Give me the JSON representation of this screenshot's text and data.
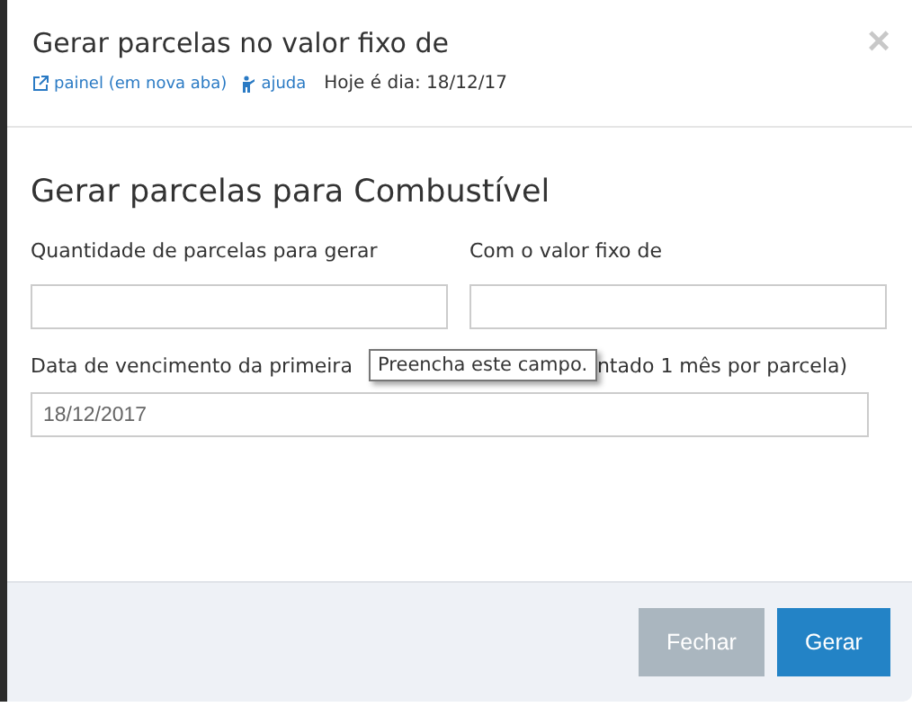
{
  "modal": {
    "title": "Gerar parcelas no valor fixo de",
    "close": "×",
    "links": [
      {
        "kind": "external",
        "label": "painel (em nova aba)"
      },
      {
        "kind": "help",
        "label": "ajuda"
      }
    ],
    "today": "Hoje é dia: 18/12/17"
  },
  "form": {
    "heading": "Gerar parcelas para Combustível",
    "quantity": {
      "label": "Quantidade de parcelas para gerar"
    },
    "fixed_value": {
      "label": "Com o valor fixo de"
    },
    "due_date": {
      "label_start": "Data de vencimento da primeira",
      "label_end": "ntado 1 mês por parcela)",
      "value": "18/12/2017"
    },
    "tooltip": "Preencha este campo."
  },
  "buttons": [
    {
      "kind": "secondary",
      "label": "Fechar"
    },
    {
      "kind": "primary",
      "label": "Gerar"
    }
  ]
}
